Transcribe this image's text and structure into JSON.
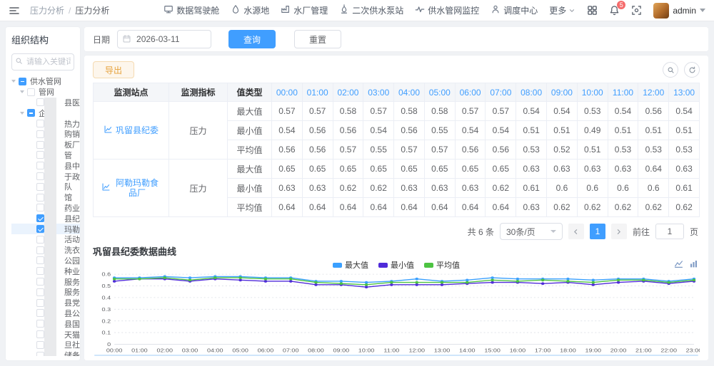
{
  "header": {
    "breadcrumb": [
      "压力分析",
      "压力分析"
    ],
    "nav": [
      {
        "icon": "dashboard-icon",
        "label": "数据驾驶舱"
      },
      {
        "icon": "water-source-icon",
        "label": "水源地"
      },
      {
        "icon": "water-plant-icon",
        "label": "水厂管理"
      },
      {
        "icon": "pump-station-icon",
        "label": "二次供水泵站"
      },
      {
        "icon": "pipe-network-icon",
        "label": "供水管网监控"
      },
      {
        "icon": "dispatch-icon",
        "label": "调度中心"
      }
    ],
    "more_label": "更多",
    "notification_count": "5",
    "user": "admin"
  },
  "sidebar": {
    "title": "组织结构",
    "search_placeholder": "请输入关键词查询",
    "tree": [
      {
        "label": "供水管网",
        "level": 0,
        "checkbox": "indeterminate",
        "expanded": true
      },
      {
        "label": "管网",
        "level": 1,
        "checkbox": "unchecked",
        "expanded": true
      },
      {
        "label": "县医院",
        "level": 2,
        "checkbox": "unchecked",
        "masked": true
      },
      {
        "label": "企",
        "level": 1,
        "checkbox": "indeterminate",
        "expanded": true
      },
      {
        "label": "热力公司",
        "level": 2,
        "checkbox": "unchecked",
        "masked": true
      },
      {
        "label": "购销公司",
        "level": 2,
        "checkbox": "unchecked",
        "masked": true
      },
      {
        "label": "板厂",
        "level": 2,
        "checkbox": "unchecked",
        "masked": true
      },
      {
        "label": "管",
        "level": 2,
        "checkbox": "unchecked",
        "masked": true
      },
      {
        "label": "县中医院",
        "level": 2,
        "checkbox": "unchecked",
        "masked": true
      },
      {
        "label": "于政社区",
        "level": 2,
        "checkbox": "unchecked",
        "masked": true
      },
      {
        "label": "队",
        "level": 2,
        "checkbox": "unchecked",
        "masked": true
      },
      {
        "label": "馆",
        "level": 2,
        "checkbox": "unchecked",
        "masked": true
      },
      {
        "label": "药业",
        "level": 2,
        "checkbox": "unchecked",
        "masked": true
      },
      {
        "label": "县纪委",
        "level": 2,
        "checkbox": "checked",
        "masked": true
      },
      {
        "label": "玛勒食品",
        "level": 2,
        "checkbox": "checked",
        "masked": true,
        "highlighted": true
      },
      {
        "label": "活动中心",
        "level": 2,
        "checkbox": "unchecked",
        "masked": true
      },
      {
        "label": "洗衣厂",
        "level": 2,
        "checkbox": "unchecked",
        "masked": true
      },
      {
        "label": "公园社区",
        "level": 2,
        "checkbox": "unchecked",
        "masked": true
      },
      {
        "label": "种业",
        "level": 2,
        "checkbox": "unchecked",
        "masked": true
      },
      {
        "label": "服务中心",
        "level": 2,
        "checkbox": "unchecked",
        "masked": true
      },
      {
        "label": "服务中心",
        "level": 2,
        "checkbox": "unchecked",
        "masked": true
      },
      {
        "label": "县党校",
        "level": 2,
        "checkbox": "unchecked",
        "masked": true
      },
      {
        "label": "县公路管",
        "level": 2,
        "checkbox": "unchecked",
        "masked": true
      },
      {
        "label": "县国聚",
        "level": 2,
        "checkbox": "unchecked",
        "masked": true
      },
      {
        "label": "天猫电器",
        "level": 2,
        "checkbox": "unchecked",
        "masked": true
      },
      {
        "label": "旦社区",
        "level": 2,
        "checkbox": "unchecked",
        "masked": true
      },
      {
        "label": "储备库",
        "level": 2,
        "checkbox": "unchecked",
        "masked": true
      }
    ]
  },
  "filters": {
    "date_label": "日期",
    "date_value": "2026-03-11",
    "query_label": "查询",
    "reset_label": "重置"
  },
  "toolbar": {
    "export_label": "导出"
  },
  "table": {
    "headers": [
      "监测站点",
      "监测指标",
      "值类型",
      "00:00",
      "01:00",
      "02:00",
      "03:00",
      "04:00",
      "05:00",
      "06:00",
      "07:00",
      "08:00",
      "09:00",
      "10:00",
      "11:00",
      "12:00",
      "13:00"
    ],
    "stations": [
      {
        "name": "巩留县纪委",
        "metric": "压力",
        "rows": [
          {
            "type": "最大值",
            "values": [
              0.57,
              0.57,
              0.58,
              0.57,
              0.58,
              0.58,
              0.57,
              0.57,
              0.54,
              0.54,
              0.53,
              0.54,
              0.56,
              0.54
            ]
          },
          {
            "type": "最小值",
            "values": [
              0.54,
              0.56,
              0.56,
              0.54,
              0.56,
              0.55,
              0.54,
              0.54,
              0.51,
              0.51,
              0.49,
              0.51,
              0.51,
              0.51
            ]
          },
          {
            "type": "平均值",
            "values": [
              0.56,
              0.56,
              0.57,
              0.55,
              0.57,
              0.57,
              0.56,
              0.56,
              0.53,
              0.52,
              0.51,
              0.53,
              0.53,
              0.53
            ]
          }
        ]
      },
      {
        "name": "阿勒玛勒食品厂",
        "metric": "压力",
        "rows": [
          {
            "type": "最大值",
            "values": [
              0.65,
              0.65,
              0.65,
              0.65,
              0.65,
              0.65,
              0.65,
              0.65,
              0.63,
              0.63,
              0.63,
              0.63,
              0.64,
              0.63
            ]
          },
          {
            "type": "最小值",
            "values": [
              0.63,
              0.63,
              0.62,
              0.62,
              0.63,
              0.63,
              0.63,
              0.62,
              0.61,
              0.6,
              0.6,
              0.6,
              0.6,
              0.61
            ]
          },
          {
            "type": "平均值",
            "values": [
              0.64,
              0.64,
              0.64,
              0.64,
              0.64,
              0.64,
              0.64,
              0.64,
              0.63,
              0.62,
              0.62,
              0.62,
              0.62,
              0.62
            ]
          }
        ]
      }
    ]
  },
  "pagination": {
    "total": "共 6 条",
    "page_size": "30条/页",
    "current": "1",
    "goto_label": "前往",
    "goto_value": "1",
    "page_unit": "页"
  },
  "chart_data": {
    "type": "line",
    "title": "巩留县纪委数据曲线",
    "x": [
      "00:00",
      "01:00",
      "02:00",
      "03:00",
      "04:00",
      "05:00",
      "06:00",
      "07:00",
      "08:00",
      "09:00",
      "10:00",
      "11:00",
      "12:00",
      "13:00",
      "14:00",
      "15:00",
      "16:00",
      "17:00",
      "18:00",
      "19:00",
      "20:00",
      "21:00",
      "22:00",
      "23:00"
    ],
    "series": [
      {
        "name": "最大值",
        "color": "#3aa0ff",
        "values": [
          0.57,
          0.57,
          0.58,
          0.57,
          0.58,
          0.58,
          0.57,
          0.57,
          0.54,
          0.54,
          0.53,
          0.54,
          0.56,
          0.54,
          0.55,
          0.57,
          0.56,
          0.56,
          0.56,
          0.55,
          0.56,
          0.56,
          0.54,
          0.56
        ]
      },
      {
        "name": "最小值",
        "color": "#4f2bd9",
        "values": [
          0.54,
          0.56,
          0.56,
          0.54,
          0.56,
          0.55,
          0.54,
          0.54,
          0.51,
          0.51,
          0.49,
          0.51,
          0.51,
          0.51,
          0.52,
          0.53,
          0.53,
          0.52,
          0.53,
          0.51,
          0.53,
          0.54,
          0.52,
          0.54
        ]
      },
      {
        "name": "平均值",
        "color": "#4dc342",
        "values": [
          0.56,
          0.56,
          0.57,
          0.55,
          0.57,
          0.57,
          0.56,
          0.56,
          0.53,
          0.52,
          0.51,
          0.53,
          0.53,
          0.53,
          0.53,
          0.55,
          0.54,
          0.55,
          0.54,
          0.53,
          0.55,
          0.55,
          0.53,
          0.55
        ]
      }
    ],
    "ylim": [
      0,
      0.6
    ],
    "yticks": [
      0,
      0.1,
      0.2,
      0.3,
      0.4,
      0.5,
      0.6
    ],
    "legend_position": "top-center",
    "grid": "horizontal-dashed"
  },
  "colors": {
    "accent": "#409eff",
    "warning": "#e6a23c",
    "badge": "#f56c6c"
  }
}
